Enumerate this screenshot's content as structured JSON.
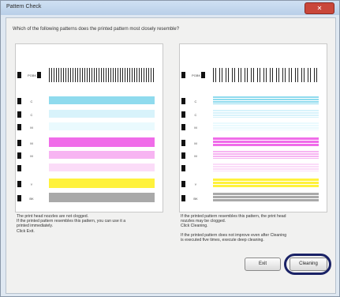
{
  "window": {
    "title": "Pattern Check",
    "close": "✕"
  },
  "question": "Which of the following patterns does the printed pattern most closely resemble?",
  "left_panel": {
    "labels": [
      "PGBK",
      "C",
      "C",
      "M",
      "M",
      "M",
      "Y",
      "BK"
    ]
  },
  "right_panel": {
    "labels": [
      "PGBK",
      "C",
      "C",
      "M",
      "M",
      "M",
      "Y",
      "BK"
    ]
  },
  "left_desc": {
    "line1": "The print head nozzles are not clogged.",
    "line2": "If the printed pattern resembles this pattern, you can use it a",
    "line3": "printed immediately.",
    "line4": "Click Exit."
  },
  "right_desc": {
    "line1": "If the printed pattern resembles this pattern, the print head",
    "line2": "nozzles may be clogged.",
    "line3": "Click Cleaning.",
    "line4": "If the printed pattern does not improve even after Cleaning",
    "line5": "is executed five times, execute deep cleaning."
  },
  "buttons": {
    "exit": "Exit",
    "cleaning": "Cleaning"
  },
  "colors": {
    "cyan": "#8fdbee",
    "magenta": "#f06ce9",
    "yellow": "#fff23c",
    "black": "#a9a9a9"
  }
}
